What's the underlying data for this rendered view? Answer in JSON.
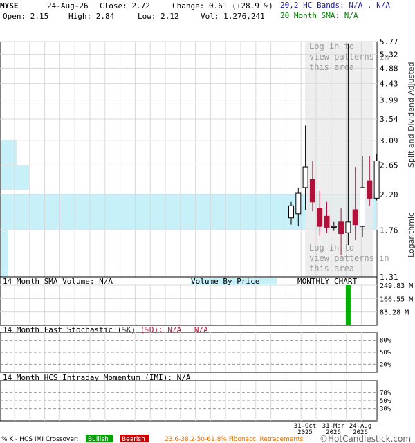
{
  "header": {
    "ticker": "MYSE",
    "date": "24-Aug-26",
    "close": "Close: 2.72",
    "change": "Change: 0.61 (+28.9 %)",
    "hc_bands": "20,2 HC Bands: N/A , N/A",
    "open": "Open: 2.15",
    "high": "High: 2.84",
    "low": "Low: 2.12",
    "vol": "Vol: 1,276,241",
    "sma20": "20 Month SMA: N/A"
  },
  "colors": {
    "up": "#ffffff",
    "down": "#b0103a",
    "vbp": "#c8f0f8",
    "shade": "#ebebeb",
    "grid": "#d8d8d8",
    "volume": "#00b000",
    "bands_text": "#1a1aa0",
    "sma_text": "#008000"
  },
  "chart_data": [
    {
      "type": "candlestick",
      "title": "",
      "scale": "logarithmic",
      "ylim": [
        1.31,
        5.77
      ],
      "y_ticks": [
        "5.77",
        "5.32",
        "4.88",
        "4.43",
        "3.99",
        "3.54",
        "3.09",
        "2.65",
        "2.20",
        "1.76",
        "1.31"
      ],
      "right_label": "Split and Dividend Adjusted",
      "right_label2": "Logarithmic",
      "watermark": "Log in to view patterns in this area",
      "candles": [
        {
          "open": 1.9,
          "high": 2.1,
          "low": 1.82,
          "close": 2.05
        },
        {
          "open": 1.95,
          "high": 2.3,
          "low": 1.8,
          "close": 2.22
        },
        {
          "open": 2.3,
          "high": 3.4,
          "low": 2.0,
          "close": 2.62
        },
        {
          "open": 2.42,
          "high": 2.72,
          "low": 1.98,
          "close": 2.1
        },
        {
          "open": 2.02,
          "high": 2.25,
          "low": 1.7,
          "close": 1.8
        },
        {
          "open": 1.92,
          "high": 2.1,
          "low": 1.73,
          "close": 1.79
        },
        {
          "open": 1.79,
          "high": 1.85,
          "low": 1.75,
          "close": 1.8
        },
        {
          "open": 1.85,
          "high": 2.02,
          "low": 1.5,
          "close": 1.72
        },
        {
          "open": 1.73,
          "high": 5.7,
          "low": 1.6,
          "close": 1.85
        },
        {
          "open": 2.0,
          "high": 2.62,
          "low": 1.65,
          "close": 1.82
        },
        {
          "open": 1.8,
          "high": 2.8,
          "low": 1.68,
          "close": 2.3
        },
        {
          "open": 2.4,
          "high": 2.8,
          "low": 2.05,
          "close": 2.15
        },
        {
          "open": 2.15,
          "high": 2.84,
          "low": 2.12,
          "close": 2.72
        }
      ],
      "volume_by_price_label": "Volume By Price"
    },
    {
      "type": "bar",
      "title": "14 Month SMA Volume: N/A",
      "chart_label": "MONTHLY CHART",
      "y_ticks": [
        "249.83 M",
        "166.55 M",
        "83.28 M"
      ],
      "ylim": [
        0,
        249.83
      ],
      "values": [
        1.5,
        1.8,
        3.5,
        2.5,
        1.2,
        1.0,
        1.1,
        1.8,
        249.8,
        1.6,
        3.8,
        1.4,
        1.3
      ]
    },
    {
      "type": "line",
      "title": "14 Month Fast Stochastic (%K)",
      "title_d": "(%D): N/A",
      "title_na": "N/A",
      "y_ticks": [
        "80%",
        "50%",
        "20%"
      ]
    },
    {
      "type": "line",
      "title": "14 Month HCS Intraday Momentum (IMI): N/A",
      "y_ticks": [
        "70%",
        "50%",
        "30%"
      ],
      "x_labels": [
        "31-Oct 2025",
        "31-Mar 2026",
        "24-Aug 2026"
      ]
    }
  ],
  "footer": {
    "crossover": "% K - HCS IMI Crossover:",
    "bullish": "Bullish",
    "bearish": "Bearish",
    "fib": "23.6-38.2-50-61.8% Fibonacci Retracements",
    "brand": "©HotCandlestick.com"
  }
}
